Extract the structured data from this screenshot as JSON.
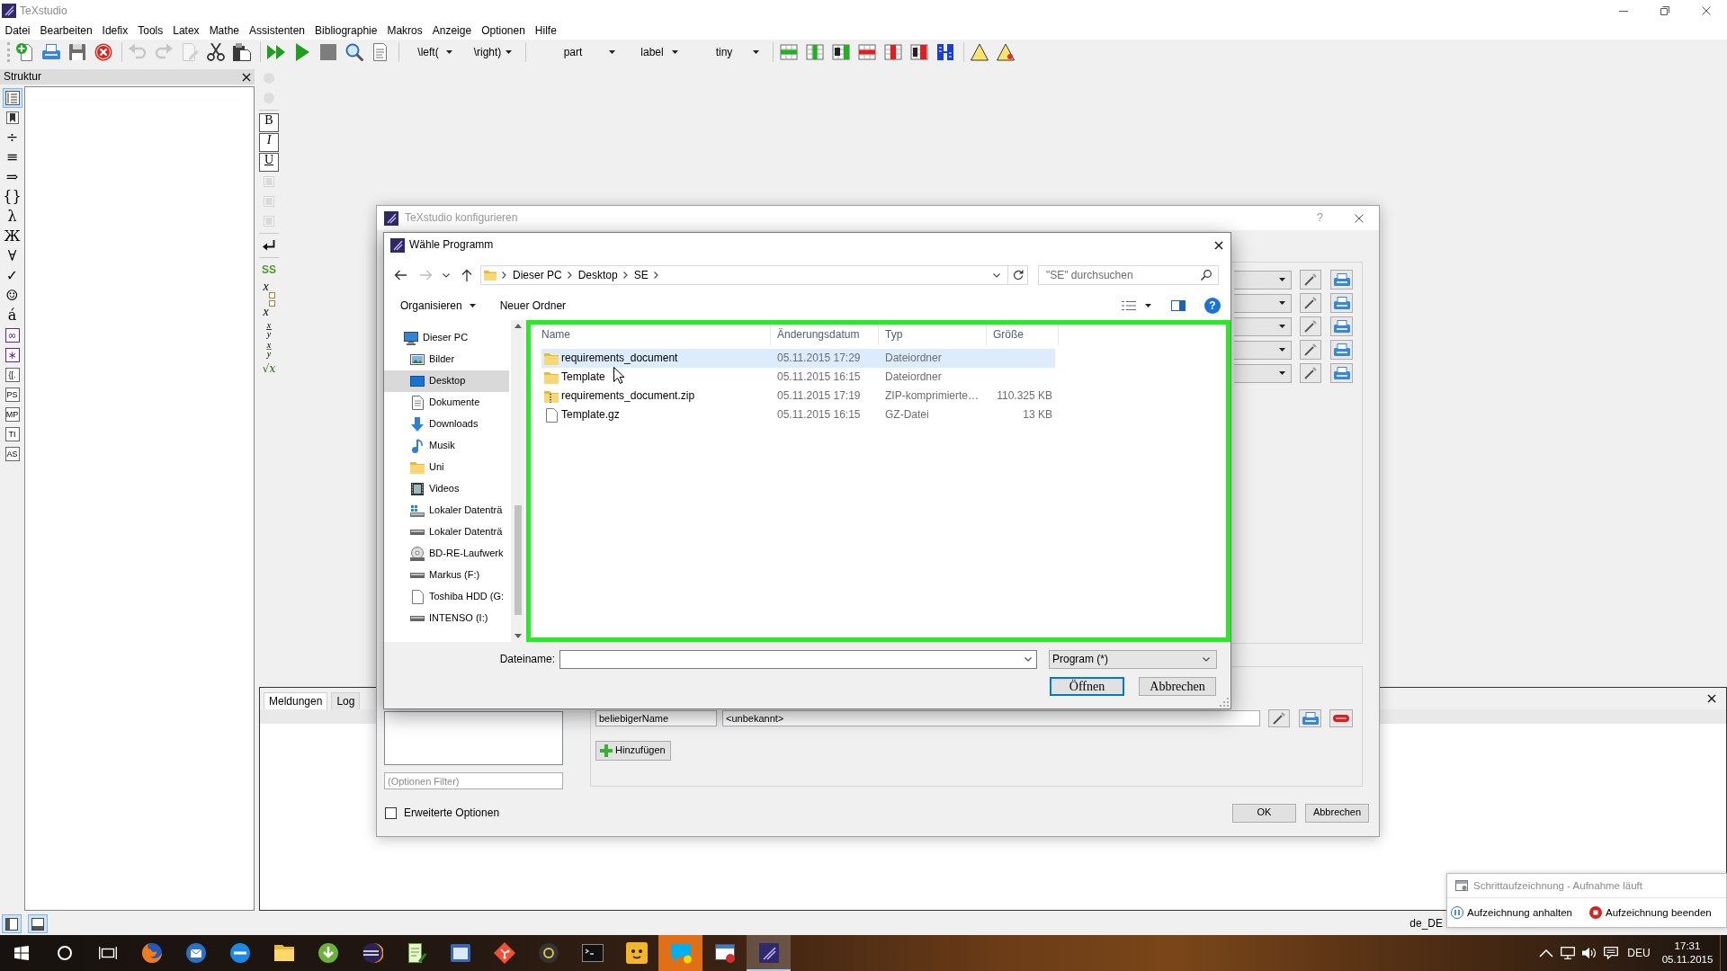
{
  "window": {
    "title": "TeXstudio"
  },
  "menu": [
    "Datei",
    "Bearbeiten",
    "Idefix",
    "Tools",
    "Latex",
    "Mathe",
    "Assistenten",
    "Bibliographie",
    "Makros",
    "Anzeige",
    "Optionen",
    "Hilfe"
  ],
  "toolbar": {
    "groups": [
      [
        {
          "kind": "tool",
          "disabled": false
        },
        {
          "kind": "tool",
          "disabled": false
        },
        {
          "kind": "tool",
          "disabled": false
        },
        {
          "kind": "tool",
          "disabled": false
        }
      ],
      [
        {
          "kind": "tool",
          "disabled": true
        },
        {
          "kind": "tool",
          "disabled": true
        },
        {
          "kind": "tool",
          "disabled": true
        },
        {
          "kind": "tool",
          "disabled": false
        },
        {
          "kind": "tool",
          "disabled": false
        }
      ],
      [
        {
          "kind": "tool",
          "disabled": false
        },
        {
          "kind": "tool",
          "disabled": false
        },
        {
          "kind": "tool",
          "disabled": false
        },
        {
          "kind": "tool",
          "disabled": false
        },
        {
          "kind": "tool",
          "disabled": false
        }
      ],
      [
        {
          "kind": "combo",
          "value": "\\left("
        },
        {
          "kind": "combo",
          "value": "\\right)"
        }
      ],
      [
        {
          "kind": "combo",
          "value": "part"
        },
        {
          "kind": "combo",
          "value": "label"
        },
        {
          "kind": "combo",
          "value": "tiny"
        }
      ],
      [
        {
          "kind": "tool",
          "disabled": false
        },
        {
          "kind": "tool",
          "disabled": false
        },
        {
          "kind": "tool",
          "disabled": false
        },
        {
          "kind": "tool",
          "disabled": false
        },
        {
          "kind": "tool",
          "disabled": false
        },
        {
          "kind": "tool",
          "disabled": false
        },
        {
          "kind": "tool",
          "disabled": false
        }
      ],
      [
        {
          "kind": "tool",
          "disabled": false
        },
        {
          "kind": "tool",
          "disabled": false
        }
      ]
    ]
  },
  "structure": {
    "title": "Struktur",
    "side_tabs": [
      {
        "kind": "outline",
        "selected": true
      },
      {
        "kind": "bookmark",
        "selected": false
      },
      {
        "kind": "glyph",
        "glyph": "÷",
        "selected": false
      },
      {
        "kind": "glyph",
        "glyph": "≡",
        "selected": false
      },
      {
        "kind": "glyph",
        "glyph": "⇒",
        "selected": false
      },
      {
        "kind": "glyph",
        "glyph": "{}",
        "selected": false
      },
      {
        "kind": "glyph",
        "glyph": "λ",
        "selected": false
      },
      {
        "kind": "glyph",
        "glyph": "Ж",
        "selected": false
      },
      {
        "kind": "glyph",
        "glyph": "∀",
        "selected": false
      },
      {
        "kind": "glyph",
        "glyph": "✓",
        "selected": false
      },
      {
        "kind": "glyph",
        "glyph": "☺",
        "selected": false
      },
      {
        "kind": "glyph",
        "glyph": "á",
        "selected": false
      },
      {
        "kind": "symbol",
        "glyph": "∞",
        "selected": false
      },
      {
        "kind": "symbol",
        "glyph": "∗",
        "selected": false
      },
      {
        "kind": "boxed",
        "glyph": "{[.",
        "selected": false
      },
      {
        "kind": "boxed",
        "glyph": "PS",
        "selected": false
      },
      {
        "kind": "boxed",
        "glyph": "MP",
        "selected": false
      },
      {
        "kind": "boxed",
        "glyph": "TI",
        "selected": false
      },
      {
        "kind": "boxed",
        "glyph": "AS",
        "selected": false
      }
    ]
  },
  "format_toolbar": {
    "groups": [
      [
        {
          "kind": "dot",
          "disabled": true
        },
        {
          "kind": "dot",
          "disabled": true
        }
      ],
      [
        {
          "kind": "bold",
          "glyph": "B",
          "disabled": false
        },
        {
          "kind": "italic",
          "glyph": "I",
          "disabled": false
        },
        {
          "kind": "underline",
          "glyph": "U",
          "disabled": false
        },
        {
          "kind": "align",
          "disabled": true
        },
        {
          "kind": "align",
          "disabled": true
        },
        {
          "kind": "align",
          "disabled": true
        }
      ],
      [
        {
          "kind": "newline",
          "disabled": false
        }
      ],
      [
        {
          "kind": "sans",
          "glyph": "SS",
          "disabled": false
        },
        {
          "kind": "sub",
          "glyph": "x",
          "disabled": false
        },
        {
          "kind": "sup",
          "glyph": "x",
          "disabled": false
        },
        {
          "kind": "frac",
          "glyph": "x",
          "denominator": "y",
          "disabled": false
        },
        {
          "kind": "slashfrac",
          "glyph": "x",
          "denominator": "y",
          "disabled": false
        },
        {
          "kind": "sqrt",
          "glyph": "√x",
          "disabled": false
        }
      ]
    ]
  },
  "messages": {
    "tabs": [
      {
        "label": "Meldungen",
        "selected": true
      },
      {
        "label": "Log",
        "selected": false
      }
    ]
  },
  "status_bar": {
    "toggles": [
      {
        "on": true
      },
      {
        "on": true
      }
    ],
    "language": "de_DE"
  },
  "settings_dialog": {
    "title": "TeXstudio konfigurieren",
    "help": "?",
    "user_commands": [
      {
        "name": "beliebigerName",
        "command": "<unbekannt>"
      }
    ],
    "add_button": "Hinzufügen",
    "filter": {
      "placeholder": "(Optionen Filter)"
    },
    "advanced_options": {
      "label": "Erweiterte Optionen",
      "checked": false
    },
    "buttons": [
      "OK",
      "Abbrechen"
    ]
  },
  "file_dialog": {
    "title": "Wähle Programm",
    "breadcrumb": [
      "Dieser PC",
      "Desktop",
      "SE"
    ],
    "search": {
      "placeholder": "\"SE\" durchsuchen"
    },
    "commands": [
      {
        "label": "Organisieren",
        "menu": true
      },
      {
        "label": "Neuer Ordner",
        "menu": false
      }
    ],
    "help": "?",
    "nav": [
      {
        "label": "Dieser PC",
        "kind": "computer",
        "selected": false,
        "children": [
          {
            "label": "Bilder",
            "kind": "pictures",
            "selected": false
          },
          {
            "label": "Desktop",
            "kind": "desktop",
            "selected": true
          },
          {
            "label": "Dokumente",
            "kind": "documents",
            "selected": false
          },
          {
            "label": "Downloads",
            "kind": "downloads",
            "selected": false
          },
          {
            "label": "Musik",
            "kind": "music",
            "selected": false
          },
          {
            "label": "Uni",
            "kind": "folder",
            "selected": false
          },
          {
            "label": "Videos",
            "kind": "videos",
            "selected": false
          },
          {
            "label": "Lokaler Datenträ",
            "kind": "systemdrive",
            "selected": false
          },
          {
            "label": "Lokaler Datenträ",
            "kind": "drive",
            "selected": false
          },
          {
            "label": "BD-RE-Laufwerk",
            "kind": "disc",
            "selected": false
          },
          {
            "label": "Markus (F:)",
            "kind": "drive",
            "selected": false
          },
          {
            "label": "Toshiba HDD (G:",
            "kind": "page",
            "selected": false
          },
          {
            "label": "INTENSO (I:)",
            "kind": "drive",
            "selected": false
          }
        ]
      }
    ],
    "columns": [
      "Name",
      "Änderungsdatum",
      "Typ",
      "Größe"
    ],
    "files": [
      {
        "name": "requirements_document",
        "kind": "folder",
        "date": "05.11.2015 17:29",
        "type": "Dateiordner",
        "selected": true
      },
      {
        "name": "Template",
        "kind": "folder",
        "date": "05.11.2015 16:15",
        "type": "Dateiordner",
        "selected": false
      },
      {
        "name": "requirements_document.zip",
        "kind": "zip",
        "date": "05.11.2015 17:19",
        "type": "ZIP-komprimierte…",
        "size": "110.325 KB",
        "selected": false
      },
      {
        "name": "Template.gz",
        "kind": "file",
        "date": "05.11.2015 16:15",
        "type": "GZ-Datei",
        "size": "13 KB",
        "selected": false
      }
    ],
    "filename": {
      "label": "Dateiname:"
    },
    "file_type": {
      "value": "Program (*)"
    },
    "buttons": [
      {
        "label": "Öffnen",
        "default": true
      },
      {
        "label": "Abbrechen",
        "default": false
      }
    ]
  },
  "notification": {
    "title": "Schrittaufzeichnung - Aufnahme läuft",
    "actions": [
      {
        "kind": "pause",
        "label": "Aufzeichnung anhalten"
      },
      {
        "kind": "stop",
        "label": "Aufzeichnung beenden"
      }
    ]
  },
  "taskbar": {
    "apps": [
      {
        "active": false,
        "attention": false
      },
      {
        "active": false,
        "attention": false
      },
      {
        "active": false,
        "attention": false
      },
      {
        "active": false,
        "attention": false
      },
      {
        "active": false,
        "attention": false
      },
      {
        "active": false,
        "attention": false
      },
      {
        "active": false,
        "attention": false
      },
      {
        "active": false,
        "attention": false
      },
      {
        "active": false,
        "attention": false
      },
      {
        "active": false,
        "attention": false
      },
      {
        "active": false,
        "attention": false
      },
      {
        "active": false,
        "attention": false
      },
      {
        "active": false,
        "attention": true
      },
      {
        "active": false,
        "attention": false
      },
      {
        "active": true,
        "attention": false
      }
    ],
    "tray": {
      "language": "DEU",
      "time": "17:31",
      "date": "05.11.2015"
    }
  }
}
